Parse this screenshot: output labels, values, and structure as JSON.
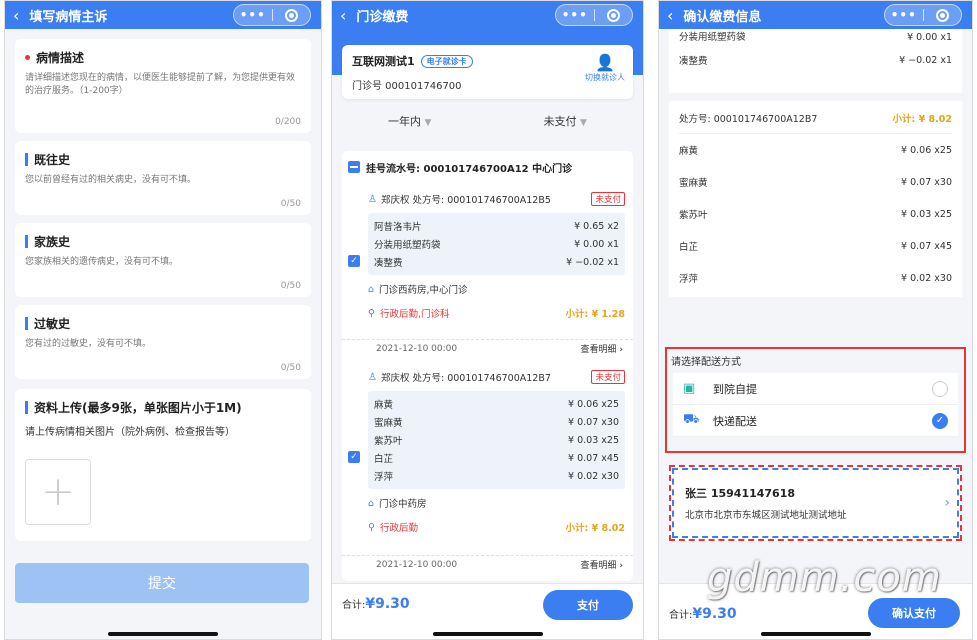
{
  "screen1": {
    "title": "填写病情主诉",
    "sections": [
      {
        "title": "病情描述",
        "desc": "请详细描述您现在的病情，以便医生能够提前了解，为您提供更有效的治疗服务。（1-200字）",
        "count": "0/200"
      },
      {
        "title": "既往史",
        "desc": "您以前曾经有过的相关病史，没有可不填。",
        "count": "0/50"
      },
      {
        "title": "家族史",
        "desc": "您家族相关的遗传病史，没有可不填。",
        "count": "0/50"
      },
      {
        "title": "过敏史",
        "desc": "您有过的过敏史，没有可不填。",
        "count": "0/50"
      }
    ],
    "upload": {
      "title": "资料上传(最多9张，单张图片小于1M)",
      "desc": "请上传病情相关图片（院外病例、检查报告等）",
      "plus": "+"
    },
    "submit": "提交"
  },
  "screen2": {
    "title": "门诊缴费",
    "patient": {
      "name": "互联网测试1",
      "card_tag": "电子就诊卡",
      "number": "门诊号 000101746700",
      "switch": "切换就诊人"
    },
    "filter": {
      "period": "一年内",
      "status": "未支付"
    },
    "register": "挂号流水号: 000101746700A12  中心门诊",
    "prescriptions": [
      {
        "doctor": "郑庆权  处方号: 000101746700A12B5",
        "status": "未支付",
        "meds": [
          {
            "name": "阿昔洛韦片",
            "price": "¥ 0.65 x2"
          },
          {
            "name": "分装用纸塑药袋",
            "price": "¥ 0.00 x1"
          },
          {
            "name": "凑整费",
            "price": "¥ −0.02 x1"
          }
        ],
        "pharmacy": "门诊西药房,中心门诊",
        "dept": "行政后勤,门诊科",
        "subtotal": "小计: ¥ 1.28",
        "date": "2021-12-10 00:00",
        "more": "查看明细"
      },
      {
        "doctor": "郑庆权  处方号: 000101746700A12B7",
        "status": "未支付",
        "meds": [
          {
            "name": "麻黄",
            "price": "¥ 0.06 x25"
          },
          {
            "name": "蜜麻黄",
            "price": "¥ 0.07 x30"
          },
          {
            "name": "紫苏叶",
            "price": "¥ 0.03 x25"
          },
          {
            "name": "白芷",
            "price": "¥ 0.07 x45"
          },
          {
            "name": "浮萍",
            "price": "¥ 0.02 x30"
          }
        ],
        "pharmacy": "门诊中药房",
        "dept": "行政后勤",
        "subtotal": "小计: ¥ 8.02",
        "date": "2021-12-10 00:00",
        "more": "查看明细"
      }
    ],
    "total_label": "合计:",
    "total_value": "¥9.30",
    "pay": "支付"
  },
  "screen3": {
    "title": "确认缴费信息",
    "top_meds": [
      {
        "name": "分装用纸塑药袋",
        "price": "¥ 0.00 x1"
      },
      {
        "name": "凑整费",
        "price": "¥ −0.02 x1"
      }
    ],
    "presc_no": "处方号: 000101746700A12B7",
    "presc_subtotal": "小计: ¥ 8.02",
    "meds": [
      {
        "name": "麻黄",
        "price": "¥ 0.06 x25"
      },
      {
        "name": "蜜麻黄",
        "price": "¥ 0.07 x30"
      },
      {
        "name": "紫苏叶",
        "price": "¥ 0.03 x25"
      },
      {
        "name": "白芷",
        "price": "¥ 0.07 x45"
      },
      {
        "name": "浮萍",
        "price": "¥ 0.02 x30"
      }
    ],
    "delivery_title": "请选择配送方式",
    "options": [
      {
        "label": "到院自提",
        "selected": false
      },
      {
        "label": "快递配送",
        "selected": true
      }
    ],
    "address": {
      "name": "张三  15941147618",
      "line": "北京市北京市东城区测试地址测试地址"
    },
    "total_label": "合计:",
    "total_value": "¥9.30",
    "confirm": "确认支付"
  },
  "watermark": "gdmm.com",
  "colors": {
    "primary": "#3a7ef1",
    "warning": "#e33",
    "subtotal": "#e8a317"
  }
}
